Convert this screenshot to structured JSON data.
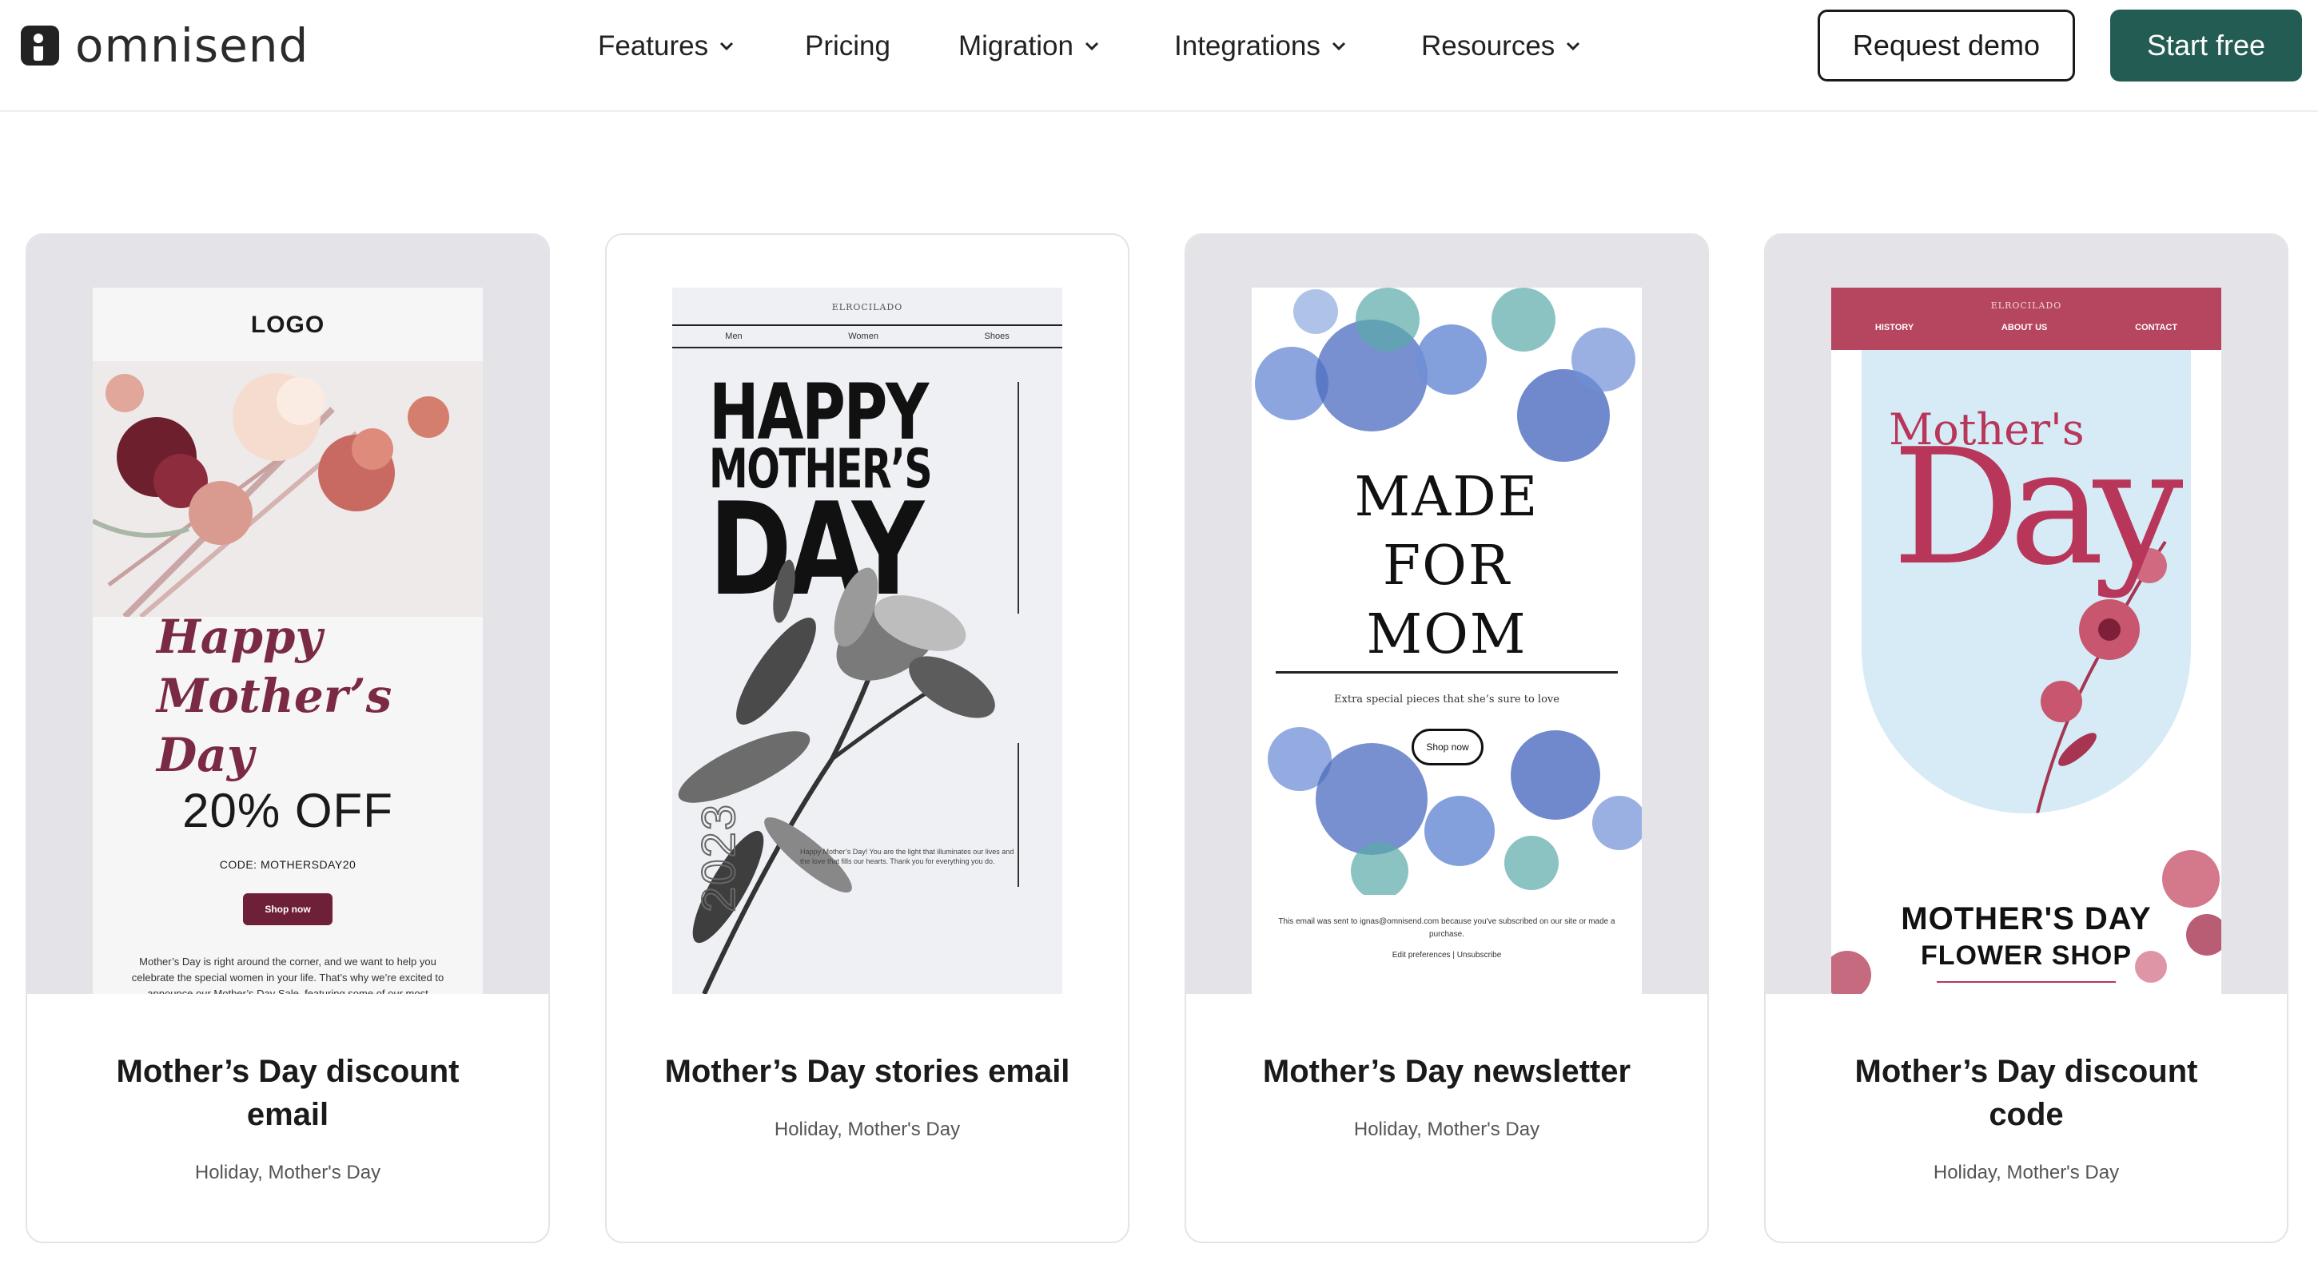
{
  "brand": {
    "name": "omnisend",
    "logo_icon": "omnisend-logo-icon"
  },
  "nav": {
    "items": [
      {
        "label": "Features",
        "has_dropdown": true
      },
      {
        "label": "Pricing",
        "has_dropdown": false
      },
      {
        "label": "Migration",
        "has_dropdown": true
      },
      {
        "label": "Integrations",
        "has_dropdown": true
      },
      {
        "label": "Resources",
        "has_dropdown": true
      }
    ],
    "request_demo_label": "Request demo",
    "start_free_label": "Start free"
  },
  "colors": {
    "accent": "#235c52",
    "text": "#1a1a1a",
    "card_border": "#e4e4e6",
    "preview_bg": "#e4e4e8"
  },
  "cards": [
    {
      "title": "Mother’s Day discount email",
      "tags": [
        "Holiday",
        "Mother's Day"
      ],
      "email": {
        "logo": "LOGO",
        "script": "Happy Mother’s Day",
        "offer": "20% OFF",
        "code": "CODE: MOTHERSDAY20",
        "button": "Shop now",
        "paragraph": "Mother’s Day is right around the corner, and we want to help you celebrate the special women in your life. That’s why we’re excited to announce our Mother’s Day Sale, featuring some of our most"
      }
    },
    {
      "title": "Mother’s Day stories email",
      "tags": [
        "Holiday",
        "Mother's Day"
      ],
      "email": {
        "brand": "ELROCILADO",
        "nav": [
          "Men",
          "Women",
          "Shoes"
        ],
        "headline_1": "HAPPY",
        "headline_2": "MOTHER’S",
        "headline_3": "DAY",
        "year": "2023",
        "small_text": "Happy Mother’s Day! You are the light that illuminates our lives and the love that fills our hearts. Thank you for everything you do."
      }
    },
    {
      "title": "Mother’s Day newsletter",
      "tags": [
        "Holiday",
        "Mother's Day"
      ],
      "email": {
        "title_lines": [
          "MADE",
          "FOR",
          "MOM"
        ],
        "subtitle": "Extra special pieces that she’s sure to love",
        "button": "Shop now",
        "footer": "This email was sent to ignas@omnisend.com because you've subscribed on our site or made a purchase.",
        "footer_links": "Edit preferences | Unsubscribe"
      }
    },
    {
      "title": "Mother’s Day discount code",
      "tags": [
        "Holiday",
        "Mother's Day"
      ],
      "email": {
        "brand": "ELROCILADO",
        "nav": [
          "HISTORY",
          "ABOUT US",
          "CONTACT"
        ],
        "script_1": "Mother's",
        "script_2": "Day",
        "bottom_1": "MOTHER'S DAY",
        "bottom_2": "FLOWER SHOP"
      }
    }
  ]
}
